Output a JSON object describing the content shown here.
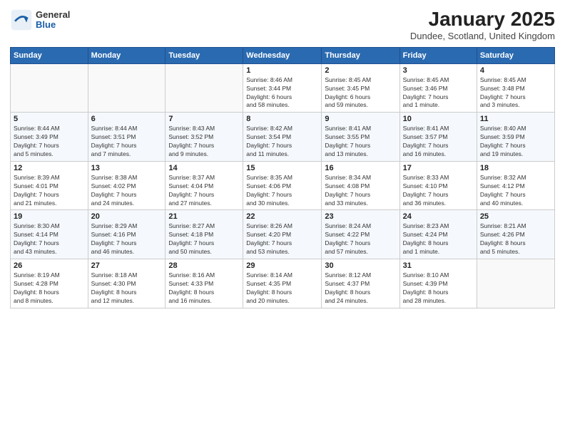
{
  "logo": {
    "general": "General",
    "blue": "Blue"
  },
  "title": "January 2025",
  "location": "Dundee, Scotland, United Kingdom",
  "days_header": [
    "Sunday",
    "Monday",
    "Tuesday",
    "Wednesday",
    "Thursday",
    "Friday",
    "Saturday"
  ],
  "weeks": [
    [
      {
        "day": "",
        "info": ""
      },
      {
        "day": "",
        "info": ""
      },
      {
        "day": "",
        "info": ""
      },
      {
        "day": "1",
        "info": "Sunrise: 8:46 AM\nSunset: 3:44 PM\nDaylight: 6 hours\nand 58 minutes."
      },
      {
        "day": "2",
        "info": "Sunrise: 8:45 AM\nSunset: 3:45 PM\nDaylight: 6 hours\nand 59 minutes."
      },
      {
        "day": "3",
        "info": "Sunrise: 8:45 AM\nSunset: 3:46 PM\nDaylight: 7 hours\nand 1 minute."
      },
      {
        "day": "4",
        "info": "Sunrise: 8:45 AM\nSunset: 3:48 PM\nDaylight: 7 hours\nand 3 minutes."
      }
    ],
    [
      {
        "day": "5",
        "info": "Sunrise: 8:44 AM\nSunset: 3:49 PM\nDaylight: 7 hours\nand 5 minutes."
      },
      {
        "day": "6",
        "info": "Sunrise: 8:44 AM\nSunset: 3:51 PM\nDaylight: 7 hours\nand 7 minutes."
      },
      {
        "day": "7",
        "info": "Sunrise: 8:43 AM\nSunset: 3:52 PM\nDaylight: 7 hours\nand 9 minutes."
      },
      {
        "day": "8",
        "info": "Sunrise: 8:42 AM\nSunset: 3:54 PM\nDaylight: 7 hours\nand 11 minutes."
      },
      {
        "day": "9",
        "info": "Sunrise: 8:41 AM\nSunset: 3:55 PM\nDaylight: 7 hours\nand 13 minutes."
      },
      {
        "day": "10",
        "info": "Sunrise: 8:41 AM\nSunset: 3:57 PM\nDaylight: 7 hours\nand 16 minutes."
      },
      {
        "day": "11",
        "info": "Sunrise: 8:40 AM\nSunset: 3:59 PM\nDaylight: 7 hours\nand 19 minutes."
      }
    ],
    [
      {
        "day": "12",
        "info": "Sunrise: 8:39 AM\nSunset: 4:01 PM\nDaylight: 7 hours\nand 21 minutes."
      },
      {
        "day": "13",
        "info": "Sunrise: 8:38 AM\nSunset: 4:02 PM\nDaylight: 7 hours\nand 24 minutes."
      },
      {
        "day": "14",
        "info": "Sunrise: 8:37 AM\nSunset: 4:04 PM\nDaylight: 7 hours\nand 27 minutes."
      },
      {
        "day": "15",
        "info": "Sunrise: 8:35 AM\nSunset: 4:06 PM\nDaylight: 7 hours\nand 30 minutes."
      },
      {
        "day": "16",
        "info": "Sunrise: 8:34 AM\nSunset: 4:08 PM\nDaylight: 7 hours\nand 33 minutes."
      },
      {
        "day": "17",
        "info": "Sunrise: 8:33 AM\nSunset: 4:10 PM\nDaylight: 7 hours\nand 36 minutes."
      },
      {
        "day": "18",
        "info": "Sunrise: 8:32 AM\nSunset: 4:12 PM\nDaylight: 7 hours\nand 40 minutes."
      }
    ],
    [
      {
        "day": "19",
        "info": "Sunrise: 8:30 AM\nSunset: 4:14 PM\nDaylight: 7 hours\nand 43 minutes."
      },
      {
        "day": "20",
        "info": "Sunrise: 8:29 AM\nSunset: 4:16 PM\nDaylight: 7 hours\nand 46 minutes."
      },
      {
        "day": "21",
        "info": "Sunrise: 8:27 AM\nSunset: 4:18 PM\nDaylight: 7 hours\nand 50 minutes."
      },
      {
        "day": "22",
        "info": "Sunrise: 8:26 AM\nSunset: 4:20 PM\nDaylight: 7 hours\nand 53 minutes."
      },
      {
        "day": "23",
        "info": "Sunrise: 8:24 AM\nSunset: 4:22 PM\nDaylight: 7 hours\nand 57 minutes."
      },
      {
        "day": "24",
        "info": "Sunrise: 8:23 AM\nSunset: 4:24 PM\nDaylight: 8 hours\nand 1 minute."
      },
      {
        "day": "25",
        "info": "Sunrise: 8:21 AM\nSunset: 4:26 PM\nDaylight: 8 hours\nand 5 minutes."
      }
    ],
    [
      {
        "day": "26",
        "info": "Sunrise: 8:19 AM\nSunset: 4:28 PM\nDaylight: 8 hours\nand 8 minutes."
      },
      {
        "day": "27",
        "info": "Sunrise: 8:18 AM\nSunset: 4:30 PM\nDaylight: 8 hours\nand 12 minutes."
      },
      {
        "day": "28",
        "info": "Sunrise: 8:16 AM\nSunset: 4:33 PM\nDaylight: 8 hours\nand 16 minutes."
      },
      {
        "day": "29",
        "info": "Sunrise: 8:14 AM\nSunset: 4:35 PM\nDaylight: 8 hours\nand 20 minutes."
      },
      {
        "day": "30",
        "info": "Sunrise: 8:12 AM\nSunset: 4:37 PM\nDaylight: 8 hours\nand 24 minutes."
      },
      {
        "day": "31",
        "info": "Sunrise: 8:10 AM\nSunset: 4:39 PM\nDaylight: 8 hours\nand 28 minutes."
      },
      {
        "day": "",
        "info": ""
      }
    ]
  ]
}
